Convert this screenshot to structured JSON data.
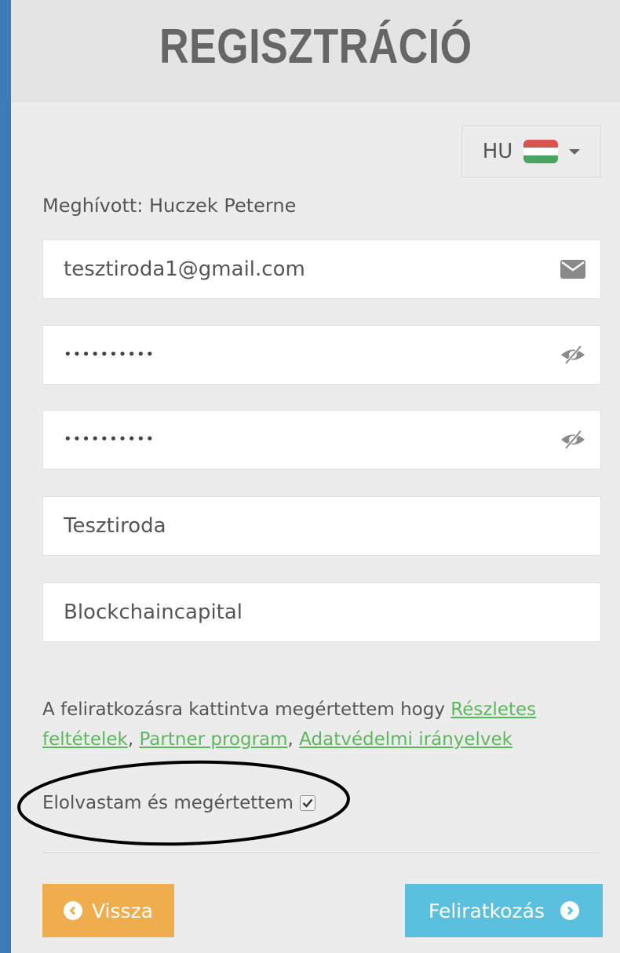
{
  "header": {
    "title": "REGISZTRÁCIÓ"
  },
  "language": {
    "code": "HU",
    "flag_colors": [
      "#d9534f",
      "#ffffff",
      "#4aa564"
    ]
  },
  "invited_by": "Meghívott: Huczek Peterne",
  "form": {
    "email": {
      "value": "tesztiroda1@gmail.com",
      "icon": "envelope-icon"
    },
    "password": {
      "masked_value": "••••••••••",
      "icon": "eye-slash-icon"
    },
    "password_confirm": {
      "masked_value": "••••••••••",
      "icon": "eye-slash-icon"
    },
    "company": {
      "value": "Tesztiroda"
    },
    "referrer": {
      "value": "Blockchaincapital"
    }
  },
  "terms": {
    "text": "A feliratkozásra kattintva megértettem hogy ",
    "links": [
      "Részletes feltételek",
      "Partner program",
      "Adatvédelmi irányelvek"
    ],
    "separator": ", ",
    "link_color": "#5cb85c"
  },
  "agreement": {
    "label": "Elolvastam és megértettem",
    "checked": true
  },
  "buttons": {
    "back": {
      "label": "Vissza",
      "color": "#f0ad4e",
      "icon": "chevron-left-circle-icon"
    },
    "submit": {
      "label": "Feliratkozás",
      "color": "#5bc0de",
      "icon": "chevron-right-circle-icon"
    }
  }
}
